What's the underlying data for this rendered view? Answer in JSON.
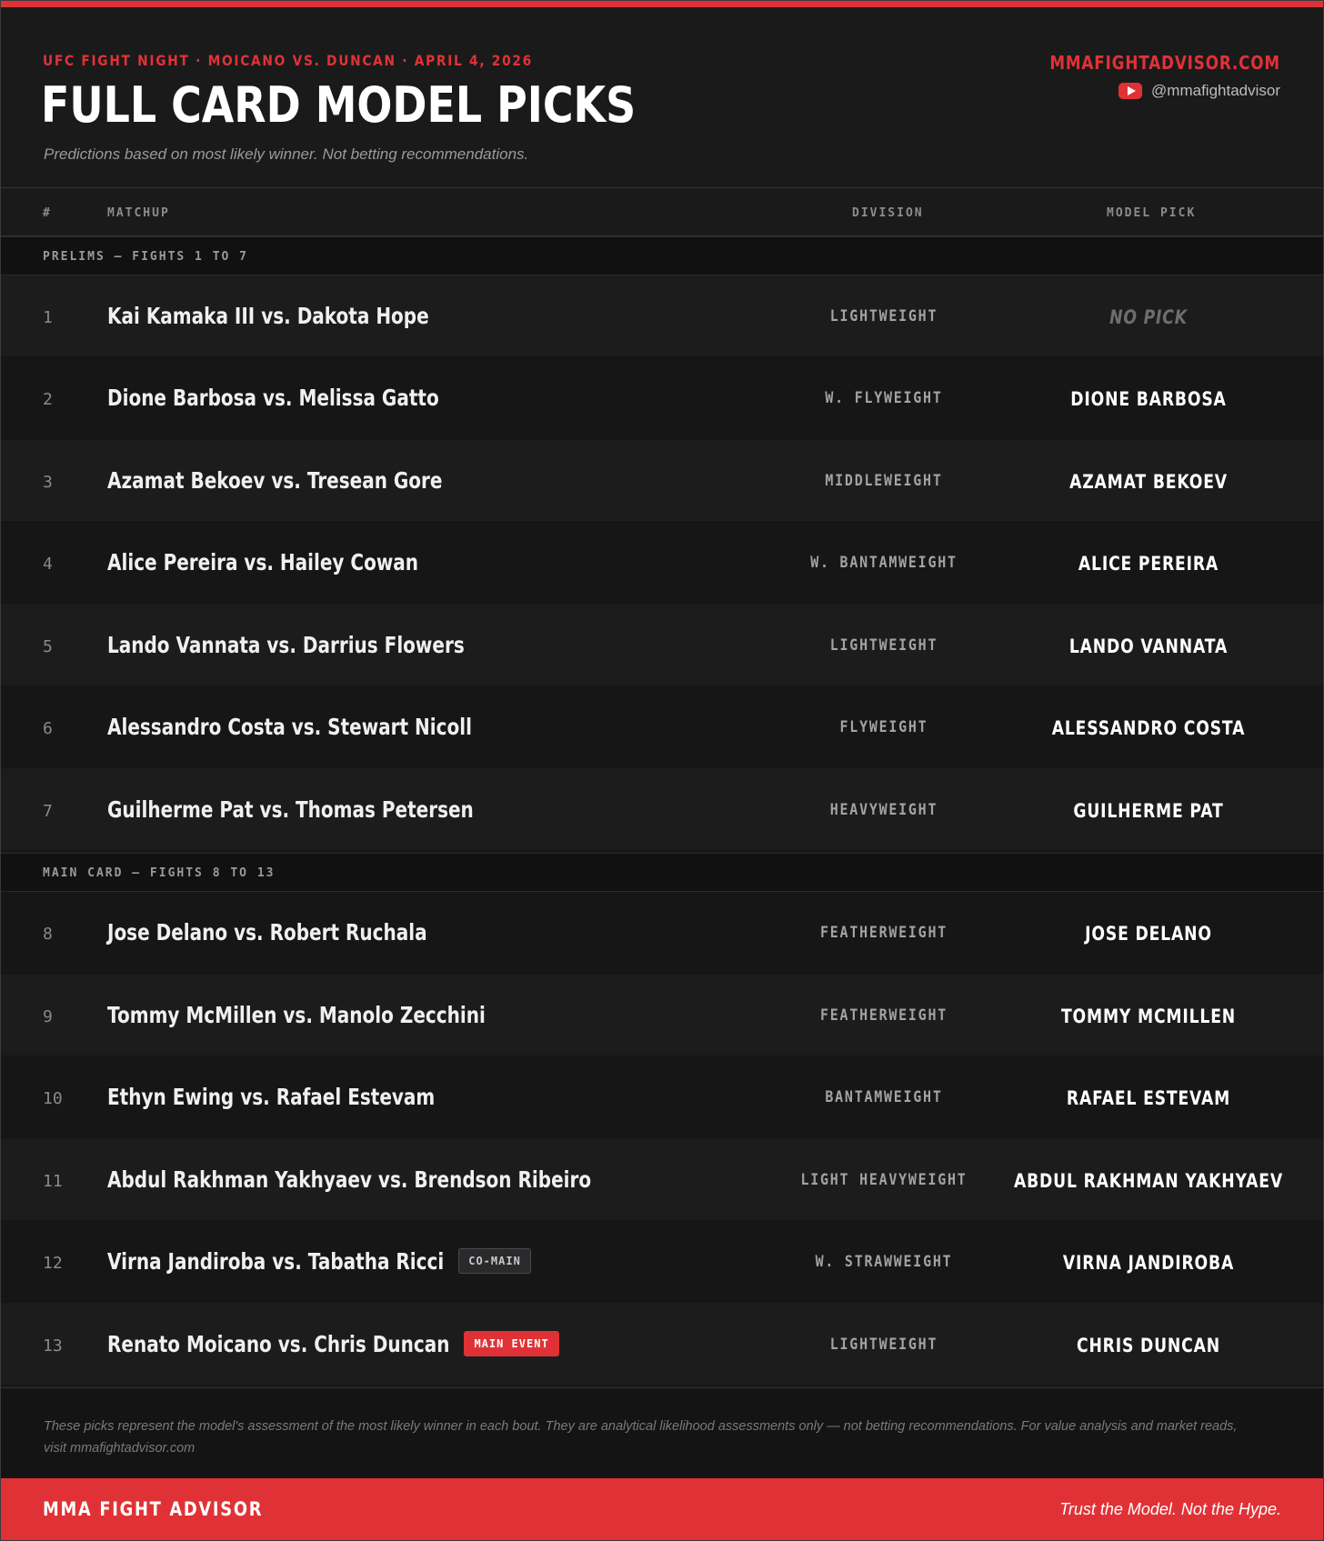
{
  "header": {
    "kicker": "UFC FIGHT NIGHT · MOICANO VS. DUNCAN · APRIL 4, 2026",
    "title": "FULL CARD MODEL PICKS",
    "subtitle": "Predictions based on most likely winner. Not betting recommendations.",
    "site": "MMAFIGHTADVISOR.COM",
    "youtube_handle": "@mmafightadvisor",
    "youtube_icon": "youtube-icon"
  },
  "columns": {
    "num": "#",
    "matchup": "MATCHUP",
    "division": "DIVISION",
    "pick": "MODEL PICK"
  },
  "sections": {
    "prelims": "PRELIMS — FIGHTS 1 TO 7",
    "main_card": "MAIN CARD — FIGHTS 8 TO 13"
  },
  "fights": [
    {
      "num": "1",
      "matchup": "Kai Kamaka III vs. Dakota Hope",
      "division": "LIGHTWEIGHT",
      "pick": "NO PICK",
      "badge": ""
    },
    {
      "num": "2",
      "matchup": "Dione Barbosa vs. Melissa Gatto",
      "division": "W. FLYWEIGHT",
      "pick": "DIONE BARBOSA",
      "badge": ""
    },
    {
      "num": "3",
      "matchup": "Azamat Bekoev vs. Tresean Gore",
      "division": "MIDDLEWEIGHT",
      "pick": "AZAMAT BEKOEV",
      "badge": ""
    },
    {
      "num": "4",
      "matchup": "Alice Pereira vs. Hailey Cowan",
      "division": "W. BANTAMWEIGHT",
      "pick": "ALICE PEREIRA",
      "badge": ""
    },
    {
      "num": "5",
      "matchup": "Lando Vannata vs. Darrius Flowers",
      "division": "LIGHTWEIGHT",
      "pick": "LANDO VANNATA",
      "badge": ""
    },
    {
      "num": "6",
      "matchup": "Alessandro Costa vs. Stewart Nicoll",
      "division": "FLYWEIGHT",
      "pick": "ALESSANDRO COSTA",
      "badge": ""
    },
    {
      "num": "7",
      "matchup": "Guilherme Pat vs. Thomas Petersen",
      "division": "HEAVYWEIGHT",
      "pick": "GUILHERME PAT",
      "badge": ""
    },
    {
      "num": "8",
      "matchup": "Jose Delano vs. Robert Ruchala",
      "division": "FEATHERWEIGHT",
      "pick": "JOSE DELANO",
      "badge": ""
    },
    {
      "num": "9",
      "matchup": "Tommy McMillen vs. Manolo Zecchini",
      "division": "FEATHERWEIGHT",
      "pick": "TOMMY MCMILLEN",
      "badge": ""
    },
    {
      "num": "10",
      "matchup": "Ethyn Ewing vs. Rafael Estevam",
      "division": "BANTAMWEIGHT",
      "pick": "RAFAEL ESTEVAM",
      "badge": ""
    },
    {
      "num": "11",
      "matchup": "Abdul Rakhman Yakhyaev vs. Brendson Ribeiro",
      "division": "LIGHT HEAVYWEIGHT",
      "pick": "ABDUL RAKHMAN YAKHYAEV",
      "badge": ""
    },
    {
      "num": "12",
      "matchup": "Virna Jandiroba vs. Tabatha Ricci",
      "division": "W. STRAWWEIGHT",
      "pick": "VIRNA JANDIROBA",
      "badge": "CO-MAIN"
    },
    {
      "num": "13",
      "matchup": "Renato Moicano vs. Chris Duncan",
      "division": "LIGHTWEIGHT",
      "pick": "CHRIS DUNCAN",
      "badge": "MAIN EVENT"
    }
  ],
  "disclaimer": "These picks represent the model's assessment of the most likely winner in each bout. They are analytical likelihood assessments only — not betting recommendations. For value analysis and market reads, visit mmafightadvisor.com",
  "footer": {
    "brand": "MMA FIGHT ADVISOR",
    "tagline": "Trust the Model. Not the Hype."
  },
  "colors": {
    "accent": "#e03236",
    "background": "#1a1a1b",
    "text": "#f0f0f0",
    "muted": "#8c8c8c"
  }
}
